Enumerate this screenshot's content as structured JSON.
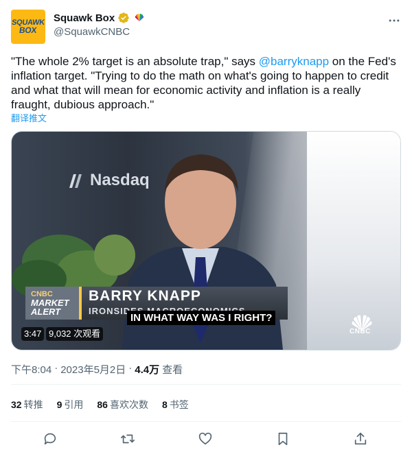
{
  "author": {
    "avatar_line1": "SQUAWK",
    "avatar_line2": "BOX",
    "name": "Squawk Box",
    "handle": "@SquawkCNBC"
  },
  "tweet": {
    "text_before": "\"The whole 2% target is an absolute trap,\" says ",
    "mention": "@barryknapp",
    "text_after": " on the Fed's inflation target. \"Trying to do the math on what's going to happen to credit and what that will mean for economic activity and inflation is a really fraught, dubious approach.\"",
    "translate_label": "翻译推文"
  },
  "video": {
    "nasdaq_label": "Nasdaq",
    "badge_line1": "CNBC",
    "badge_line2": "MARKET",
    "badge_line3": "ALERT",
    "lower_third_name": "BARRY KNAPP",
    "lower_third_title": "IRONSIDES MACROECONOMICS",
    "caption": "IN WHAT WAY WAS I RIGHT?",
    "network_logo": "CNBC",
    "duration": "3:47",
    "views": "9,032 次观看"
  },
  "meta": {
    "time": "下午8:04",
    "separator1": "·",
    "date": "2023年5月2日",
    "separator2": "·",
    "view_count": "4.4万",
    "view_label": "查看"
  },
  "stats": {
    "retweets_count": "32",
    "retweets_label": "转推",
    "quotes_count": "9",
    "quotes_label": "引用",
    "likes_count": "86",
    "likes_label": "喜欢次数",
    "bookmarks_count": "8",
    "bookmarks_label": "书签"
  },
  "icons": {
    "verified": "verified-badge-icon",
    "affiliate": "cnbc-peacock-icon",
    "more": "more-icon",
    "reply": "reply-icon",
    "retweet": "retweet-icon",
    "like": "like-icon",
    "bookmark": "bookmark-icon",
    "share": "share-icon"
  },
  "colors": {
    "accent": "#1d9bf0",
    "verified_gold": "#e2b719",
    "secondary_text": "#536471"
  }
}
